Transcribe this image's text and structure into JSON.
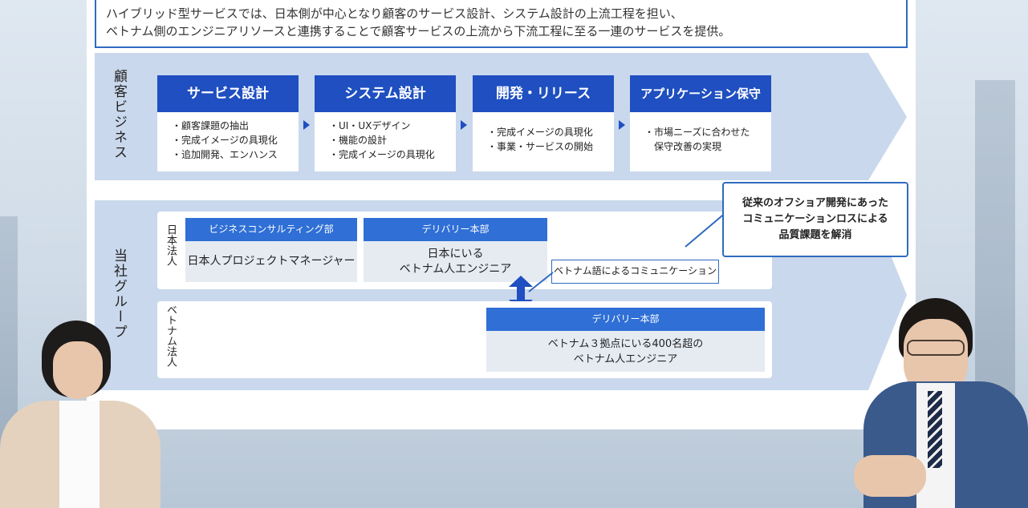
{
  "intro": {
    "line1": "ハイブリッド型サービスでは、日本側が中心となり顧客のサービス設計、システム設計の上流工程を担い、",
    "line2": "ベトナム側のエンジニアリソースと連携することで顧客サービスの上流から下流工程に至る一連のサービスを提供。"
  },
  "client_section": {
    "label": "顧客ビジネス"
  },
  "stages": [
    {
      "title": "サービス設計",
      "items": [
        "・顧客課題の抽出",
        "・完成イメージの具現化",
        "・追加開発、エンハンス"
      ]
    },
    {
      "title": "システム設計",
      "items": [
        "・UI・UXデザイン",
        "・機能の設計",
        "・完成イメージの具現化"
      ]
    },
    {
      "title": "開発・リリース",
      "items": [
        "・完成イメージの具現化",
        "・事業・サービスの開始"
      ]
    },
    {
      "title": "アプリケーション保守",
      "items": [
        "・市場ニーズに合わせた",
        "　保守改善の実現"
      ]
    }
  ],
  "group_section": {
    "label": "当社グループ",
    "japan_label": "日本法人",
    "vietnam_label": "ベトナム法人",
    "consulting": {
      "header": "ビジネスコンサルティング部",
      "body": "日本人プロジェクトマネージャー"
    },
    "delivery_jp": {
      "header": "デリバリー本部",
      "body_line1": "日本にいる",
      "body_line2": "ベトナム人エンジニア"
    },
    "delivery_vn": {
      "header": "デリバリー本部",
      "body_line1": "ベトナム３拠点にいる400名超の",
      "body_line2": "ベトナム人エンジニア"
    },
    "communication": "ベトナム語によるコミュニケーション"
  },
  "callout": {
    "line1": "従来のオフショア開発にあった",
    "line2": "コミュニケーションロスによる",
    "line3": "品質課題を解消"
  },
  "colors": {
    "primary": "#1f4fc0",
    "accent": "#2f6fd6",
    "panel": "#c9d8ec"
  }
}
